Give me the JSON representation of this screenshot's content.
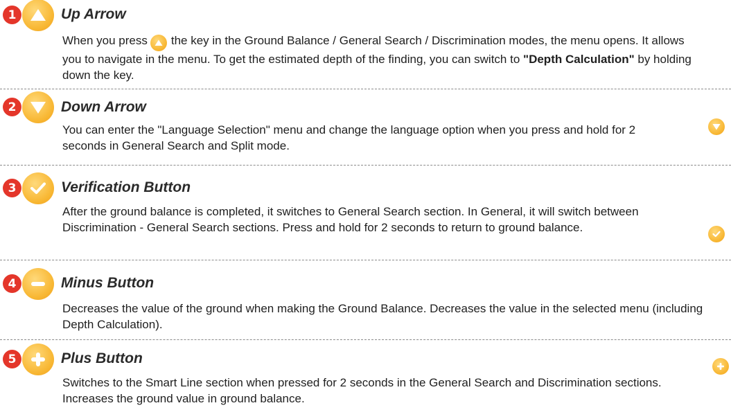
{
  "sections": [
    {
      "number": "1",
      "icon": "up-arrow-icon",
      "title": "Up Arrow",
      "body_before_icon": "When you press",
      "body_after_icon": "the key in the Ground Balance / General Search / Discrimination modes, the menu opens. It allows you to navigate in the menu. To get the estimated depth of the finding, you can switch to ",
      "body_bold": "\"Depth Calculation\"",
      "body_end": " by holding down the key."
    },
    {
      "number": "2",
      "icon": "down-arrow-icon",
      "title": "Down Arrow",
      "body": "You can enter the \"Language Selection\" menu and change the language option when you press and hold for 2 seconds in General Search and Split mode."
    },
    {
      "number": "3",
      "icon": "check-icon",
      "title": "Verification Button",
      "body": "After the ground balance is completed, it switches to General Search section. In General, it will switch between Discrimination - General Search sections. Press and hold for 2 seconds to return to ground balance."
    },
    {
      "number": "4",
      "icon": "minus-icon",
      "title": "Minus Button",
      "body": "Decreases the value of the ground when making the Ground Balance. Decreases the value in the selected menu (including Depth Calculation)."
    },
    {
      "number": "5",
      "icon": "plus-icon",
      "title": "Plus Button",
      "body": "Switches to the Smart Line section when pressed for 2 seconds in the General Search and Discrimination sections. Increases the ground value in ground balance."
    }
  ],
  "colors": {
    "badge_red": "#e4362a",
    "icon_orange": "#f8b733",
    "divider_gray": "#8a8a8a"
  }
}
